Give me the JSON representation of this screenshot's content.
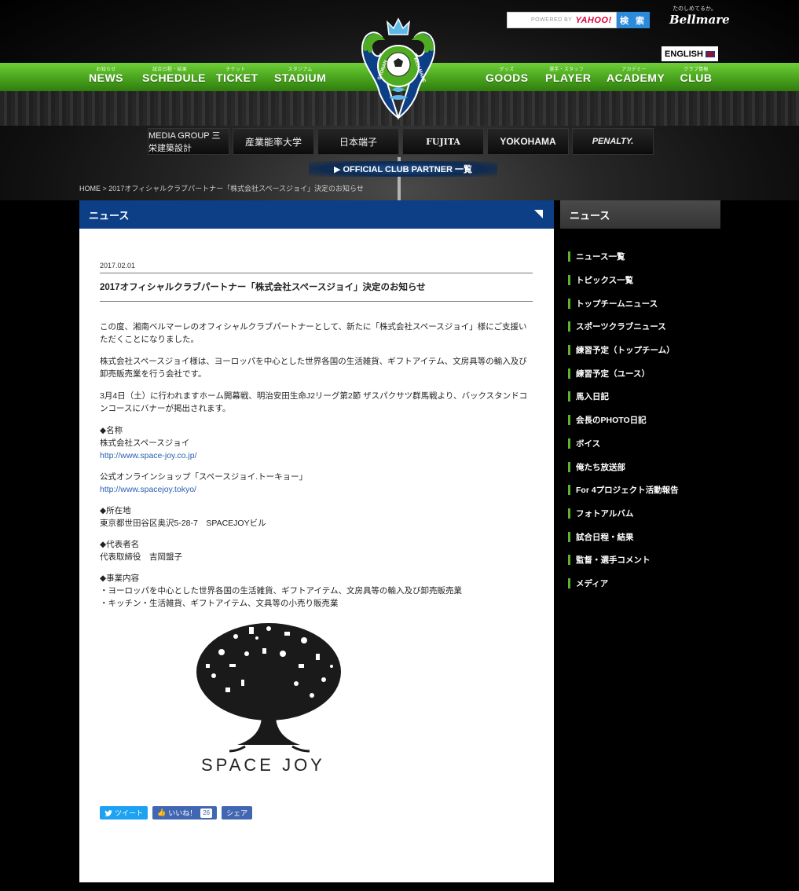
{
  "header": {
    "search": {
      "powered_by": "POWERED BY",
      "provider": "YAHOO!",
      "button": "検 索"
    },
    "brand": {
      "tagline": "たのしめてるか。",
      "name": "Bellmare"
    },
    "language": "ENGLISH",
    "logo_text": {
      "left": "SHONAN",
      "right": "BELLMARE"
    },
    "nav_left": [
      {
        "sub": "お知らせ",
        "label": "NEWS"
      },
      {
        "sub": "試合日程・結果",
        "label": "SCHEDULE"
      },
      {
        "sub": "チケット",
        "label": "TICKET"
      },
      {
        "sub": "スタジアム",
        "label": "STADIUM"
      }
    ],
    "nav_right": [
      {
        "sub": "グッズ",
        "label": "GOODS"
      },
      {
        "sub": "選手・スタッフ",
        "label": "PLAYER"
      },
      {
        "sub": "アカデミー",
        "label": "ACADEMY"
      },
      {
        "sub": "クラブ情報",
        "label": "CLUB"
      }
    ],
    "partners": [
      "MEDIA GROUP 三栄建築設計",
      "産業能率大学",
      "日本端子",
      "FUJITA",
      "YOKOHAMA",
      "PENALTY."
    ],
    "partner_link": "▶ OFFICIAL CLUB PARTNER 一覧"
  },
  "breadcrumb": {
    "home": "HOME",
    "sep": ">",
    "current": "2017オフィシャルクラブパートナー「株式会社スペースジョイ」決定のお知らせ"
  },
  "main": {
    "section_title": "ニュース",
    "date": "2017.02.01",
    "title": "2017オフィシャルクラブパートナー「株式会社スペースジョイ」決定のお知らせ",
    "p1": "この度、湘南ベルマーレのオフィシャルクラブパートナーとして、新たに「株式会社スペースジョイ」様にご支援いただくことになりました。",
    "p2": "株式会社スペースジョイ様は、ヨーロッパを中心とした世界各国の生活雑貨、ギフトアイテム、文房具等の輸入及び卸売販売業を行う会社です。",
    "p3": "3月4日（土）に行われますホーム開幕戦、明治安田生命J2リーグ第2節 ザスパクサツ群馬戦より、バックスタンドコンコースにバナーが掲出されます。",
    "name_label": "◆名称",
    "name_value": "株式会社スペースジョイ",
    "url1": "http://www.space-joy.co.jp/",
    "shop_label": "公式オンラインショップ「スペースジョイ.トーキョー」",
    "url2": "http://www.spacejoy.tokyo/",
    "addr_label": "◆所在地",
    "addr_value": "東京都世田谷区奥沢5-28-7　SPACEJOYビル",
    "rep_label": "◆代表者名",
    "rep_value": "代表取締役　吉岡盟子",
    "biz_label": "◆事業内容",
    "biz_1": "・ヨーロッパを中心とした世界各国の生活雑貨、ギフトアイテム、文房具等の輸入及び卸売販売業",
    "biz_2": "・キッチン・生活雑貨、ギフトアイテム、文具等の小売り販売業",
    "logo_caption": "SPACE JOY",
    "share": {
      "tweet": "ツイート",
      "like": "いいね！",
      "like_count": "26",
      "share": "シェア"
    }
  },
  "sidebar": {
    "title": "ニュース",
    "items": [
      "ニュース一覧",
      "トピックス一覧",
      "トップチームニュース",
      "スポーツクラブニュース",
      "練習予定（トップチーム）",
      "練習予定（ユース）",
      "馬入日記",
      "会長のPHOTO日記",
      "ボイス",
      "俺たち放送部",
      "For 4プロジェクト活動報告",
      "フォトアルバム",
      "試合日程・結果",
      "監督・選手コメント",
      "メディア"
    ]
  },
  "colors": {
    "nav_green": "#4fab21",
    "news_blue": "#0d3f87",
    "side_bar_green": "#5cb531",
    "link_blue": "#2a5fb0"
  }
}
